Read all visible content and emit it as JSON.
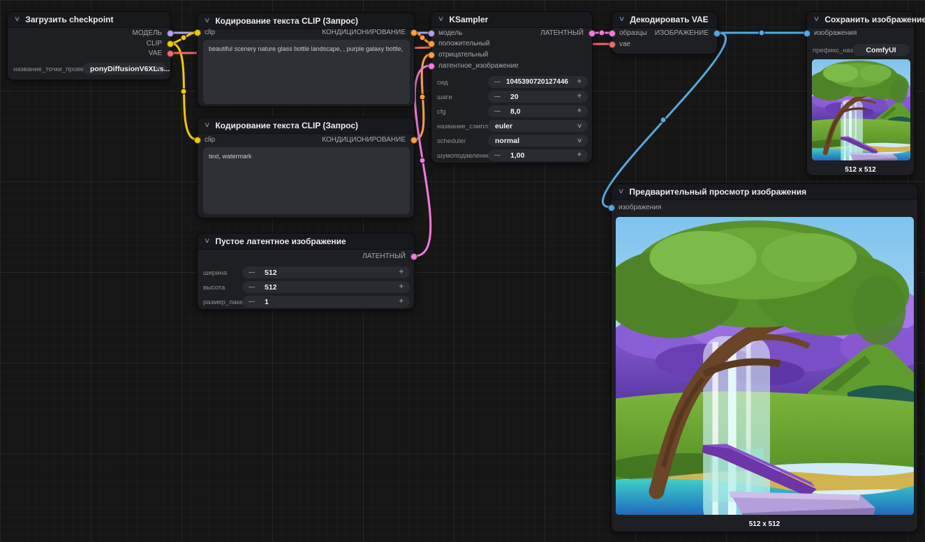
{
  "icons": {
    "collapse_chevron": "∨",
    "combo_chevron": "∨",
    "decrement": "—",
    "increment": "+"
  },
  "colors": {
    "model": "#b1a2e8",
    "clip": "#f2c900",
    "vae": "#ef6a6a",
    "conditioning": "#ff9f3c",
    "latent": "#ef7ce0",
    "image": "#58a8e0"
  },
  "nodes": {
    "checkpoint": {
      "title": "Загрузить checkpoint",
      "outputs": [
        "МОДЕЛЬ",
        "CLIP",
        "VAE"
      ],
      "widget": {
        "label": "название_точки_проверки",
        "value": "ponyDiffusionV6XL.s..."
      }
    },
    "clip_pos": {
      "title": "Кодирование текста CLIP (Запрос)",
      "input": "clip",
      "output": "КОНДИЦИОНИРОВАНИЕ",
      "text": "beautiful scenery nature glass bottle landscape, , purple galaxy bottle,"
    },
    "clip_neg": {
      "title": "Кодирование текста CLIP (Запрос)",
      "input": "clip",
      "output": "КОНДИЦИОНИРОВАНИЕ",
      "text": "text, watermark"
    },
    "empty_latent": {
      "title": "Пустое латентное изображение",
      "output": "ЛАТЕНТНЫЙ",
      "widgets": [
        {
          "label": "ширина",
          "value": "512"
        },
        {
          "label": "высота",
          "value": "512"
        },
        {
          "label": "размер_пакета",
          "value": "1"
        }
      ]
    },
    "ksampler": {
      "title": "KSampler",
      "inputs": [
        "модель",
        "положительный",
        "отрицательный",
        "латентное_изображение"
      ],
      "output": "ЛАТЕНТНЫЙ",
      "widgets": [
        {
          "label": "сид",
          "value": "1045390720127446",
          "type": "number"
        },
        {
          "label": "шаги",
          "value": "20",
          "type": "number"
        },
        {
          "label": "cfg",
          "value": "8,0",
          "type": "number"
        },
        {
          "label": "название_сэмплера",
          "value": "euler",
          "type": "combo"
        },
        {
          "label": "scheduler",
          "value": "normal",
          "type": "combo"
        },
        {
          "label": "шумоподавление",
          "value": "1,00",
          "type": "number"
        }
      ]
    },
    "vae_decode": {
      "title": "Декодировать VAE",
      "inputs": [
        "образцы",
        "vae"
      ],
      "output": "ИЗОБРАЖЕНИЕ"
    },
    "save_image": {
      "title": "Сохранить изображение",
      "input": "изображения",
      "widget": {
        "label": "префикс_наз...",
        "value": "ComfyUI"
      },
      "caption": "512 x 512"
    },
    "preview_image": {
      "title": "Предварительный просмотр изображения",
      "input": "изображения",
      "caption": "512 x 512"
    }
  }
}
